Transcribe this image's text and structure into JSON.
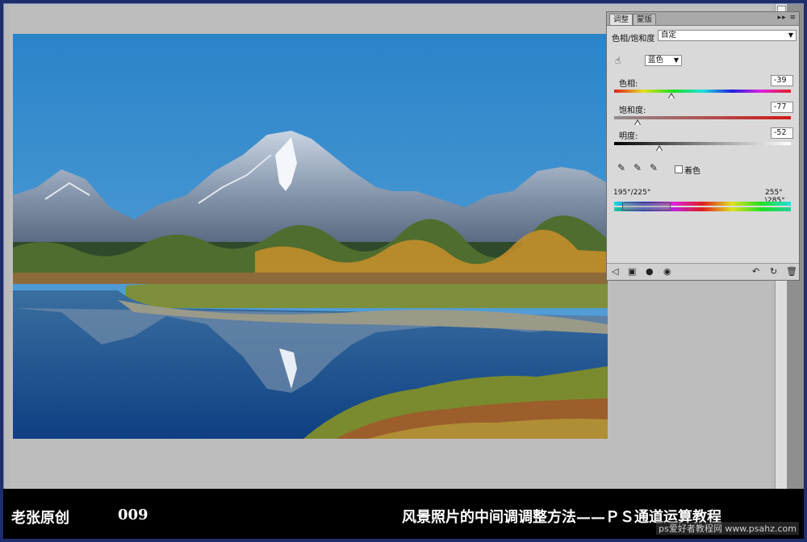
{
  "panel": {
    "tabs": [
      "调整",
      "蒙版"
    ],
    "menu_glyph": "▸▸ ≡",
    "adjustment_label": "色相/饱和度",
    "preset_value": "自定",
    "channel_value": "蓝色",
    "hue": {
      "label": "色相:",
      "value": "-39",
      "level": 0.41
    },
    "saturation": {
      "label": "饱和度:",
      "value": "-77",
      "level": 0.12
    },
    "lightness": {
      "label": "明度:",
      "value": "-52",
      "level": 0.24
    },
    "colorize_label": "着色",
    "range_left": "195°/225°",
    "range_right": "255°\\285°"
  },
  "caption": {
    "author": "老张原创",
    "number": "009",
    "title": "风景照片的中间调调整方法——ＰＳ通道运算教程",
    "watermark": "ps爱好者教程网 www.psahz.com"
  },
  "colors": {
    "background": "#1e2d6b",
    "caption_bg": "#000000",
    "panel_bg": "#d9d9d9",
    "sky": "#3f8fce"
  }
}
